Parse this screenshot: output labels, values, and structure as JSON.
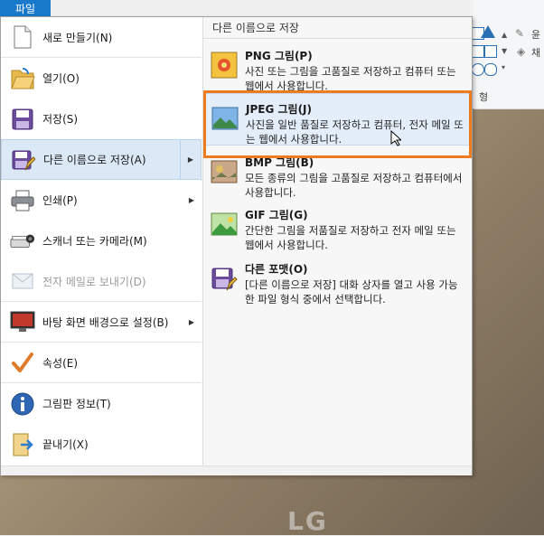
{
  "file_tab": "파일",
  "ribbon": {
    "group_label": "형",
    "right_texts": [
      "윤",
      "채"
    ]
  },
  "left_menu": [
    {
      "label": "새로 만들기(N)",
      "icon": "new-page-icon"
    },
    {
      "label": "열기(O)",
      "icon": "open-folder-icon"
    },
    {
      "label": "저장(S)",
      "icon": "save-disk-icon"
    },
    {
      "label": "다른 이름으로 저장(A)",
      "icon": "save-as-icon",
      "submenu": true,
      "active": true
    },
    {
      "label": "인쇄(P)",
      "icon": "printer-icon",
      "submenu": true
    },
    {
      "label": "스캐너 또는 카메라(M)",
      "icon": "scanner-icon"
    },
    {
      "label": "전자 메일로 보내기(D)",
      "icon": "email-icon",
      "disabled": true
    },
    {
      "label": "바탕 화면 배경으로 설정(B)",
      "icon": "desktop-background-icon",
      "submenu": true
    },
    {
      "label": "속성(E)",
      "icon": "checkmark-icon"
    },
    {
      "label": "그림판 정보(T)",
      "icon": "info-icon"
    },
    {
      "label": "끝내기(X)",
      "icon": "exit-icon"
    }
  ],
  "submenu": {
    "header": "다른 이름으로 저장",
    "items": [
      {
        "title": "PNG 그림(P)",
        "desc": "사진 또는 그림을 고품질로 저장하고 컴퓨터 또는 웹에서 사용합니다.",
        "icon": "png-image-icon"
      },
      {
        "title": "JPEG 그림(J)",
        "desc": "사진을 일반 품질로 저장하고 컴퓨터, 전자 메일 또는 웹에서 사용합니다.",
        "icon": "jpeg-image-icon",
        "hover": true
      },
      {
        "title": "BMP 그림(B)",
        "desc": "모든 종류의 그림을 고품질로 저장하고 컴퓨터에서 사용합니다.",
        "icon": "bmp-image-icon"
      },
      {
        "title": "GIF 그림(G)",
        "desc": "간단한 그림을 저품질로 저장하고 전자 메일 또는 웹에서 사용합니다.",
        "icon": "gif-image-icon"
      },
      {
        "title": "다른 포맷(O)",
        "desc": "[다른 이름으로 저장] 대화 상자를 열고 사용 가능한 파일 형식 중에서 선택합니다.",
        "icon": "other-format-icon"
      }
    ]
  },
  "colors": {
    "accent": "#1979ca",
    "highlight": "#ec7c1d",
    "active_bg": "#dbe8f6"
  }
}
